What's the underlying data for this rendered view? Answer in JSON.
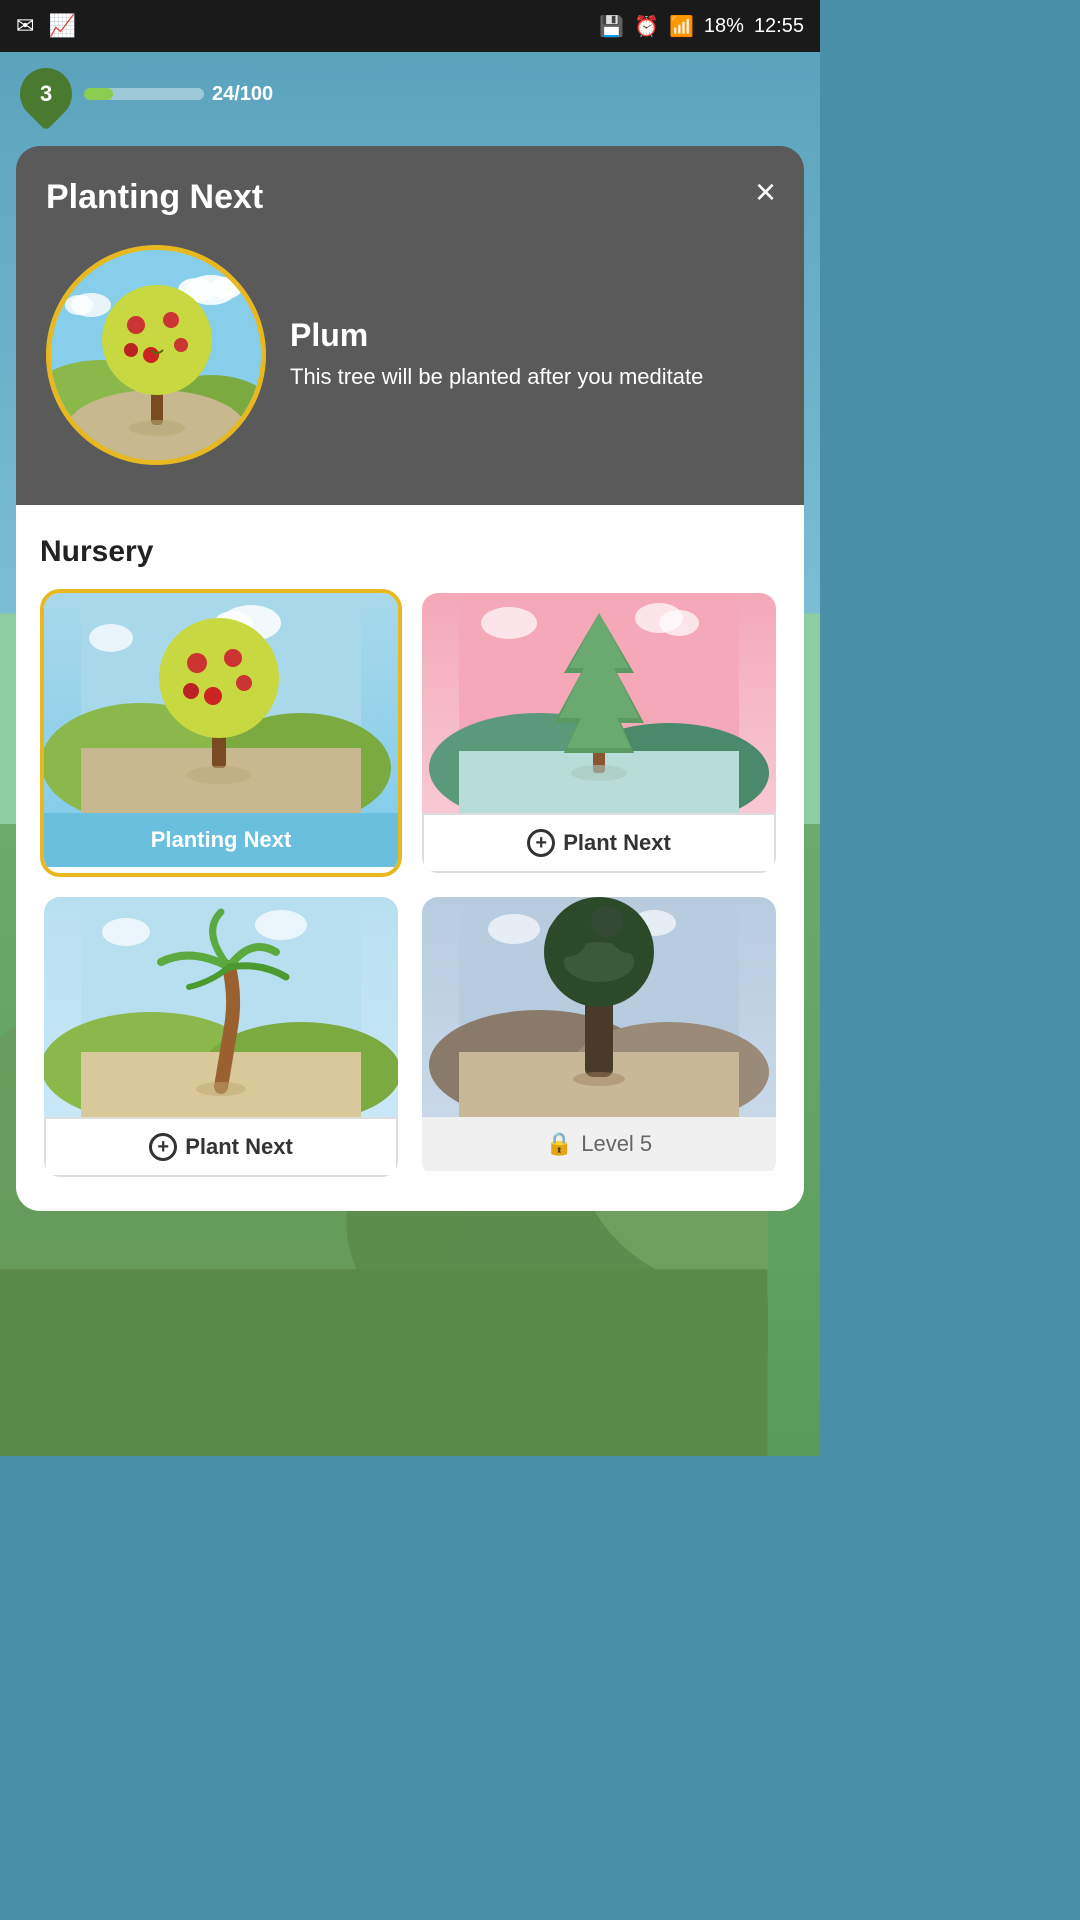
{
  "statusBar": {
    "leftIcons": [
      "✉",
      "📈"
    ],
    "battery": "18%",
    "time": "12:55",
    "rightIcons": [
      "💾",
      "⏰",
      "📶"
    ]
  },
  "topBar": {
    "leafCount": "3",
    "progress": "24/100",
    "progressPercent": 24
  },
  "modal": {
    "title": "Planting Next",
    "closeLabel": "×",
    "tree": {
      "name": "Plum",
      "description": "This tree will be planted after you meditate"
    }
  },
  "nursery": {
    "title": "Nursery",
    "cards": [
      {
        "type": "plum",
        "label": "Planting Next",
        "selected": true,
        "actionType": "selected"
      },
      {
        "type": "pine",
        "label": "Plant Next",
        "selected": false,
        "actionType": "plant"
      },
      {
        "type": "palm",
        "label": "Plant Next",
        "selected": false,
        "actionType": "plant"
      },
      {
        "type": "baobab",
        "label": "Level 5",
        "selected": false,
        "actionType": "locked"
      }
    ]
  },
  "icons": {
    "close": "×",
    "plus": "+",
    "lock": "🔒"
  }
}
